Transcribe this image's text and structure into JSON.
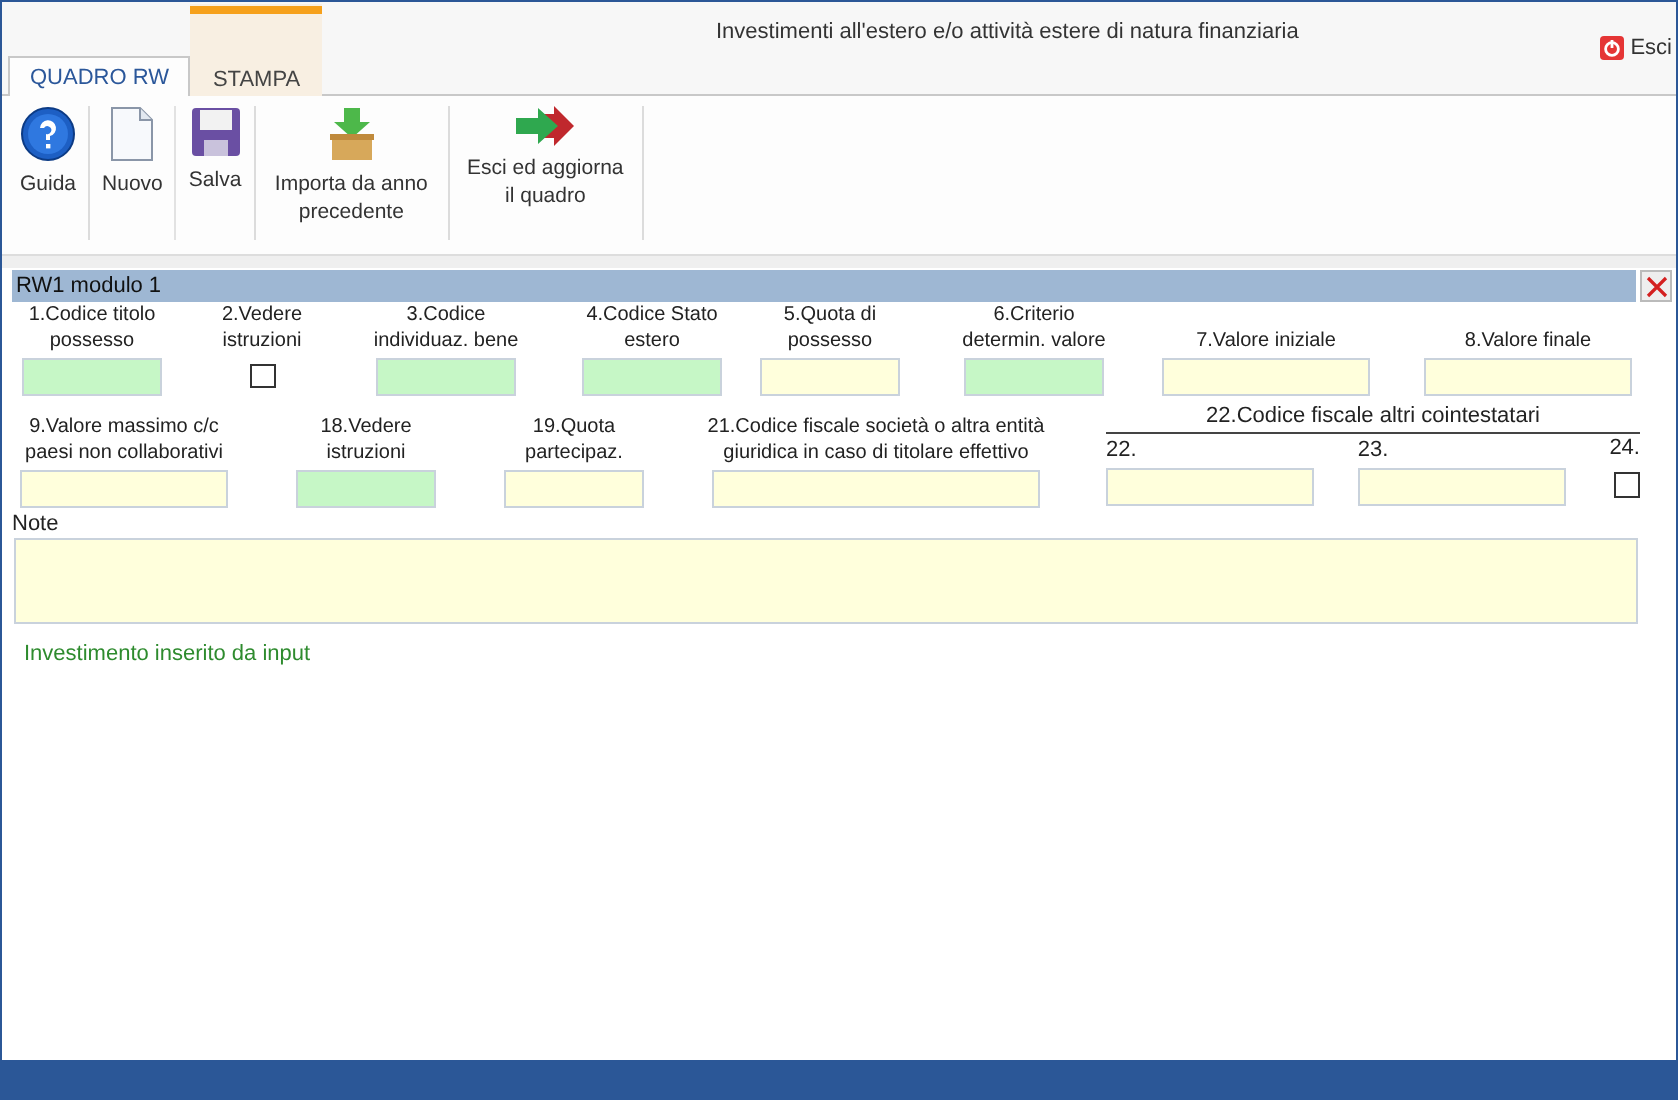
{
  "window": {
    "title": "Investimenti all'estero e/o attività estere di natura finanziaria"
  },
  "tabs": [
    {
      "label": "QUADRO RW",
      "selected": true,
      "highlighted": false
    },
    {
      "label": "STAMPA",
      "selected": false,
      "highlighted": true
    }
  ],
  "exit_button": {
    "label": "Esci"
  },
  "toolbar": [
    {
      "kind": "help",
      "label": "Guida"
    },
    {
      "kind": "new",
      "label": "Nuovo"
    },
    {
      "kind": "save",
      "label": "Salva"
    },
    {
      "kind": "import",
      "label": "Importa da anno precedente"
    },
    {
      "kind": "exit",
      "label": "Esci ed aggiorna il quadro"
    }
  ],
  "panel": {
    "title": "RW1 modulo 1",
    "row_1": [
      {
        "kind": "field",
        "label": "1.Codice titolo possesso",
        "color": "#c6f7c6"
      },
      {
        "kind": "checkbox",
        "label": "2.Vedere istruzioni",
        "checked": false
      },
      {
        "kind": "field",
        "label": "3.Codice individuaz. bene",
        "color": "#c6f7c6"
      },
      {
        "kind": "field",
        "label": "4.Codice Stato estero",
        "color": "#c6f7c6"
      },
      {
        "kind": "field",
        "label": "5.Quota di possesso",
        "color": "#ffffdc"
      },
      {
        "kind": "field",
        "label": "6.Criterio determin. valore",
        "color": "#c6f7c6"
      },
      {
        "kind": "field",
        "label": "7.Valore iniziale",
        "color": "#ffffdc"
      },
      {
        "kind": "field",
        "label": "8.Valore finale",
        "color": "#ffffdc"
      }
    ],
    "row_2": [
      {
        "kind": "field",
        "label": "9.Valore massimo c/c paesi non collaborativi",
        "color": "#ffffdc"
      },
      {
        "kind": "field",
        "label": "18.Vedere istruzioni",
        "color": "#c6f7c6"
      },
      {
        "kind": "field",
        "label": "19.Quota partecipaz.",
        "color": "#ffffdc"
      },
      {
        "kind": "field",
        "label": "21.Codice fiscale società o altra entità giuridica in caso di titolare effettivo",
        "color": "#ffffdc"
      }
    ],
    "co_owners": {
      "title": "22.Codice fiscale altri cointestatari",
      "items": [
        {
          "kind": "field",
          "label": "22.",
          "color": "#ffffdc"
        },
        {
          "kind": "field",
          "label": "23.",
          "color": "#ffffdc"
        },
        {
          "kind": "checkbox",
          "label": "24.",
          "checked": false
        }
      ]
    },
    "note": {
      "label": "Note"
    },
    "status": "Investimento inserito da input"
  }
}
